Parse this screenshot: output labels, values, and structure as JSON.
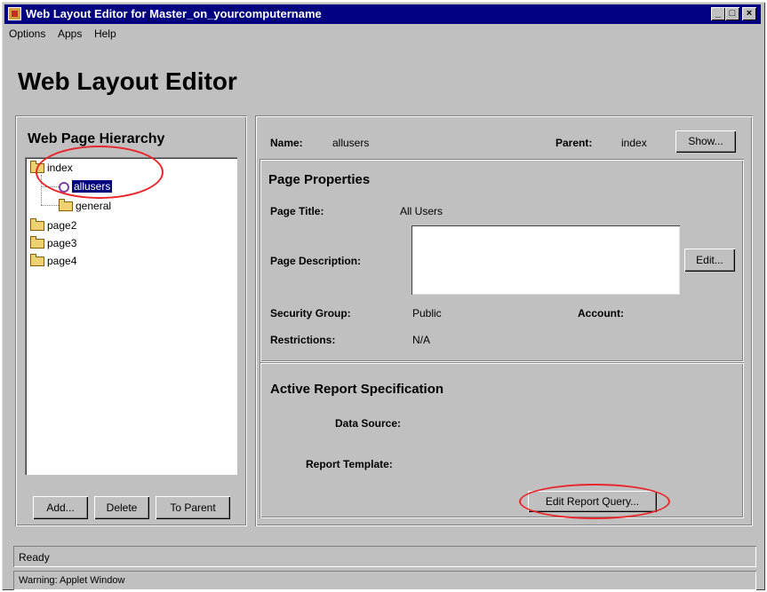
{
  "window": {
    "title": "Web Layout Editor for Master_on_yourcomputername",
    "minimize_icon": "minimize-icon",
    "maximize_icon": "maximize-icon",
    "close_icon": "close-icon",
    "minimize_glyph": "_",
    "maximize_glyph": "□",
    "close_glyph": "×"
  },
  "menu": [
    "Options",
    "Apps",
    "Help"
  ],
  "app_title": "Web Layout Editor",
  "hierarchy": {
    "title": "Web Page Hierarchy",
    "nodes": [
      {
        "label": "index",
        "icon": "open-folder-icon"
      },
      {
        "label": "allusers",
        "icon": "page-icon",
        "selected": true
      },
      {
        "label": "general",
        "icon": "folder-icon"
      },
      {
        "label": "page2",
        "icon": "open-folder-icon"
      },
      {
        "label": "page3",
        "icon": "open-folder-icon"
      },
      {
        "label": "page4",
        "icon": "open-folder-icon"
      }
    ],
    "buttons": {
      "add": "Add...",
      "delete": "Delete",
      "to_parent": "To Parent"
    }
  },
  "details": {
    "name_label": "Name:",
    "name_value": "allusers",
    "parent_label": "Parent:",
    "parent_value": "index",
    "show_button": "Show...",
    "page_properties": {
      "title": "Page Properties",
      "page_title_label": "Page Title:",
      "page_title_value": "All Users",
      "description_label": "Page Description:",
      "description_value": "",
      "edit_button": "Edit...",
      "security_group_label": "Security Group:",
      "security_group_value": "Public",
      "account_label": "Account:",
      "restrictions_label": "Restrictions:",
      "restrictions_value": "N/A"
    },
    "report_spec": {
      "title": "Active Report Specification",
      "data_source_label": "Data Source:",
      "report_template_label": "Report Template:",
      "edit_query_button": "Edit Report Query..."
    }
  },
  "status": {
    "ready": "Ready",
    "warning": "Warning: Applet Window"
  },
  "colors": {
    "selection": "#000080",
    "highlight_circle": "#e8262b",
    "title_bar": "#000080",
    "window_bg": "#c0c0c0"
  }
}
